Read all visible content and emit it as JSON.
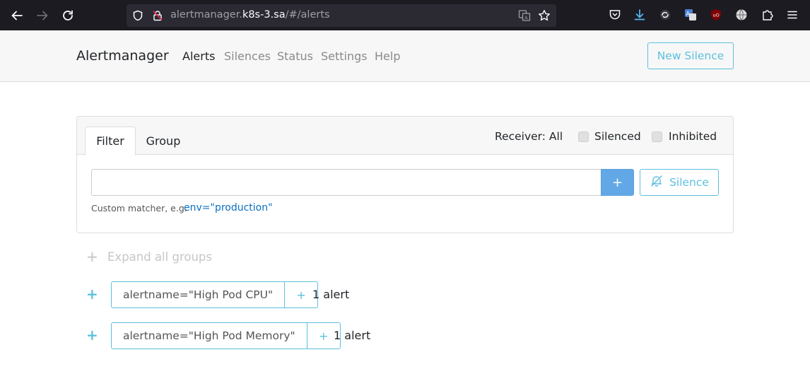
{
  "browser": {
    "url_prefix": "alertmanager.",
    "url_host": "k8s-3.sa",
    "url_suffix": "/#/alerts"
  },
  "navbar": {
    "brand": "Alertmanager",
    "links": [
      "Alerts",
      "Silences",
      "Status",
      "Settings",
      "Help"
    ],
    "active_link": "Alerts",
    "new_silence_label": "New Silence"
  },
  "filter_card": {
    "tabs": {
      "filter": "Filter",
      "group": "Group"
    },
    "receiver_label": "Receiver: All",
    "silenced_label": "Silenced",
    "inhibited_label": "Inhibited",
    "input_value": "",
    "add_label": "+",
    "silence_label": "Silence",
    "hint_text": "Custom matcher, e.g.",
    "hint_example": "env=\"production\""
  },
  "groups": {
    "expand_all_label": "Expand all groups",
    "items": [
      {
        "matcher": "alertname=\"High Pod CPU\"",
        "count": "1 alert"
      },
      {
        "matcher": "alertname=\"High Pod Memory\"",
        "count": "1 alert"
      }
    ]
  },
  "colors": {
    "accent": "#5bc0de",
    "primary_button": "#62a8e6",
    "browser_bg": "#1c1b22",
    "navbar_bg": "#f7f7f7"
  }
}
